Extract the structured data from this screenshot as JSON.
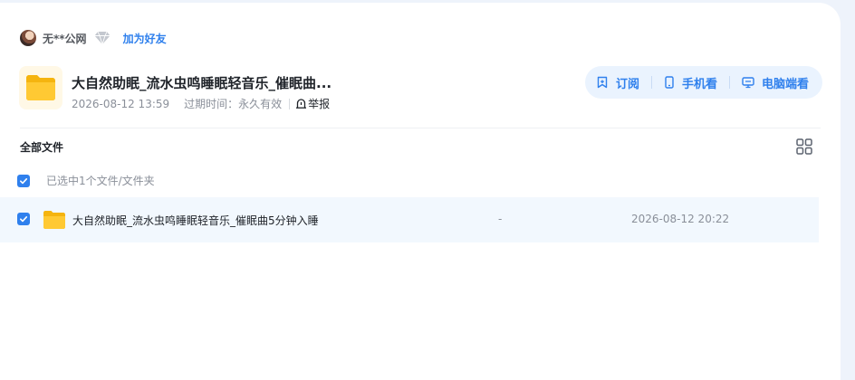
{
  "owner": {
    "name": "无**公网",
    "badge_icon": "diamond-icon",
    "add_friend_label": "加为好友"
  },
  "share": {
    "folder_icon": "folder-icon",
    "title": "大自然助眠_流水虫鸣睡眠轻音乐_催眠曲...",
    "date": "2026-08-12 13:59",
    "expire_label": "过期时间：",
    "expire_value": "永久有效",
    "report_label": "举报"
  },
  "actions": [
    {
      "icon": "bookmark-icon",
      "label": "订阅"
    },
    {
      "icon": "phone-icon",
      "label": "手机看"
    },
    {
      "icon": "monitor-icon",
      "label": "电脑端看"
    }
  ],
  "files_section": {
    "title": "全部文件",
    "view_toggle_icon": "grid-view-icon",
    "selection_text": "已选中1个文件/文件夹"
  },
  "files": [
    {
      "name": "大自然助眠_流水虫鸣睡眠轻音乐_催眠曲5分钟入睡",
      "size": "-",
      "modified": "2026-08-12 20:22",
      "checked": true
    }
  ],
  "colors": {
    "accent": "#2f80ed",
    "pill_bg": "#eaf3fe",
    "row_selected_bg": "#f2f8fe",
    "folder_yellow": "#ffc933",
    "page_bg": "#eef3fb"
  }
}
